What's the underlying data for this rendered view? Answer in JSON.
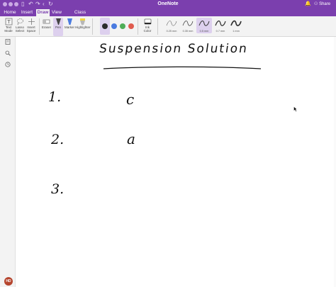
{
  "app": {
    "title": "OneNote"
  },
  "window_controls": {
    "close_color": "#caa9e4",
    "min_color": "#caa9e4",
    "max_color": "#caa9e4"
  },
  "titlebar_icons": [
    "sidebar-icon",
    "undo-icon",
    "redo-icon",
    "back-icon",
    "sync-icon"
  ],
  "right_actions": {
    "notifications_icon": "bell-icon",
    "share_label": "Share",
    "share_icon": "person-plus-icon"
  },
  "tabs": [
    {
      "label": "Home",
      "active": false
    },
    {
      "label": "Insert",
      "active": false
    },
    {
      "label": "Draw",
      "active": true
    },
    {
      "label": "View",
      "active": false
    },
    {
      "label": "Class Notebook",
      "active": false
    }
  ],
  "ribbon": {
    "tools": [
      {
        "label": "Text\nMode",
        "icon": "text-mode-icon"
      },
      {
        "label": "Lasso\nSelect",
        "icon": "lasso-icon"
      },
      {
        "label": "Insert\nSpace",
        "icon": "insert-space-icon"
      },
      {
        "label": "Eraser",
        "icon": "eraser-icon"
      },
      {
        "label": "Pen",
        "icon": "pen-icon"
      },
      {
        "label": "Marker",
        "icon": "marker-icon"
      },
      {
        "label": "Highlighter",
        "icon": "highlighter-icon"
      }
    ],
    "pen_colors": [
      "#2b2b2b",
      "#4a7be0",
      "#4fae58",
      "#e05b4e"
    ],
    "ink_color_label": "Ink\nColor",
    "thicknesses": [
      {
        "label": "0.25 mm",
        "selected": false
      },
      {
        "label": "0.35 mm",
        "selected": false
      },
      {
        "label": "0.5 mm",
        "selected": true
      },
      {
        "label": "0.7 mm",
        "selected": false
      },
      {
        "label": "1 mm",
        "selected": false
      }
    ]
  },
  "sidebar": {
    "icons": [
      "notebooks-icon",
      "search-icon",
      "recent-icon"
    ],
    "avatar_initials": "HD",
    "avatar_color": "#b5452e"
  },
  "canvas": {
    "ink_title": "Suspension   Solution",
    "items": [
      {
        "number": "1.",
        "answer": "c"
      },
      {
        "number": "2.",
        "answer": "a"
      },
      {
        "number": "3.",
        "answer": ""
      }
    ]
  },
  "colors": {
    "accent": "#7b3fae",
    "ribbon_bg": "#f3f3f3",
    "selected_tool": "#ddd0ee"
  }
}
